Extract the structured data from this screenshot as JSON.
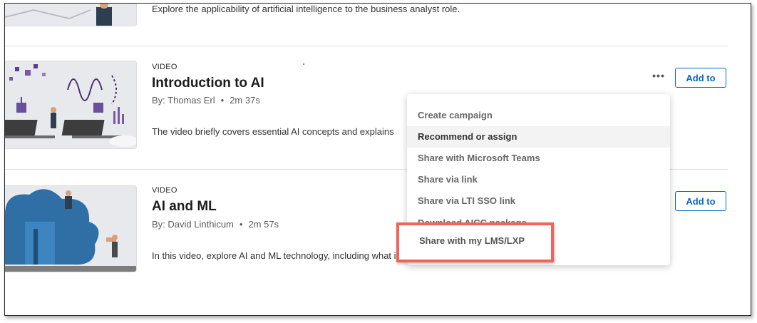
{
  "top_item": {
    "description": "Explore the applicability of artificial intelligence to the business analyst role."
  },
  "items": [
    {
      "type": "VIDEO",
      "title": "Introduction to AI",
      "author": "By: Thomas Erl",
      "separator": "•",
      "duration": "2m 37s",
      "description": "The video briefly covers essential AI concepts and explains"
    },
    {
      "type": "VIDEO",
      "title": "AI and ML",
      "author": "By: David Linthicum",
      "separator": "•",
      "duration": "2m 57s",
      "description": "In this video, explore AI and ML technology, including what i"
    }
  ],
  "actions": {
    "more_label": "•••",
    "add_label": "Add to"
  },
  "menu": {
    "items": [
      "Create campaign",
      "Recommend or assign",
      "Share with Microsoft Teams",
      "Share via link",
      "Share via LTI SSO link",
      "Download AICC package"
    ],
    "highlighted_item": "Share with my LMS/LXP"
  },
  "colors": {
    "accent": "#0a66c2",
    "highlight_border": "#f06459",
    "thumbnail_bg": "#e8e9ed"
  },
  "icons": {
    "more": "more-horizontal-icon"
  }
}
